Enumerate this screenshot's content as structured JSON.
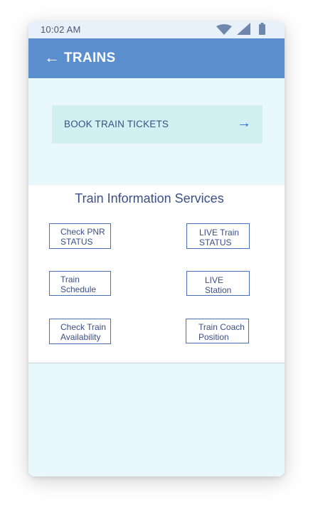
{
  "status_bar": {
    "time": "10:02 AM",
    "icons": [
      "wifi-icon",
      "signal-icon",
      "battery-icon"
    ]
  },
  "app_bar": {
    "back_icon": "←",
    "title": "TRAINS"
  },
  "book": {
    "label": "BOOK TRAIN TICKETS",
    "arrow": "→"
  },
  "services": {
    "title": "Train Information Services",
    "items": [
      {
        "label": "Check PNR\nSTATUS"
      },
      {
        "label": "LIVE Train\nSTATUS"
      },
      {
        "label": "Train\nSchedule"
      },
      {
        "label": "LIVE\nStation"
      },
      {
        "label": "Check Train\nAvailability"
      },
      {
        "label": "Train Coach\nPosition"
      }
    ]
  },
  "colors": {
    "app_bar": "#5b8ece",
    "background": "#e8f8fc",
    "book_button": "#d2f0f2",
    "text": "#3b4f86",
    "accent": "#2a6fd6"
  }
}
